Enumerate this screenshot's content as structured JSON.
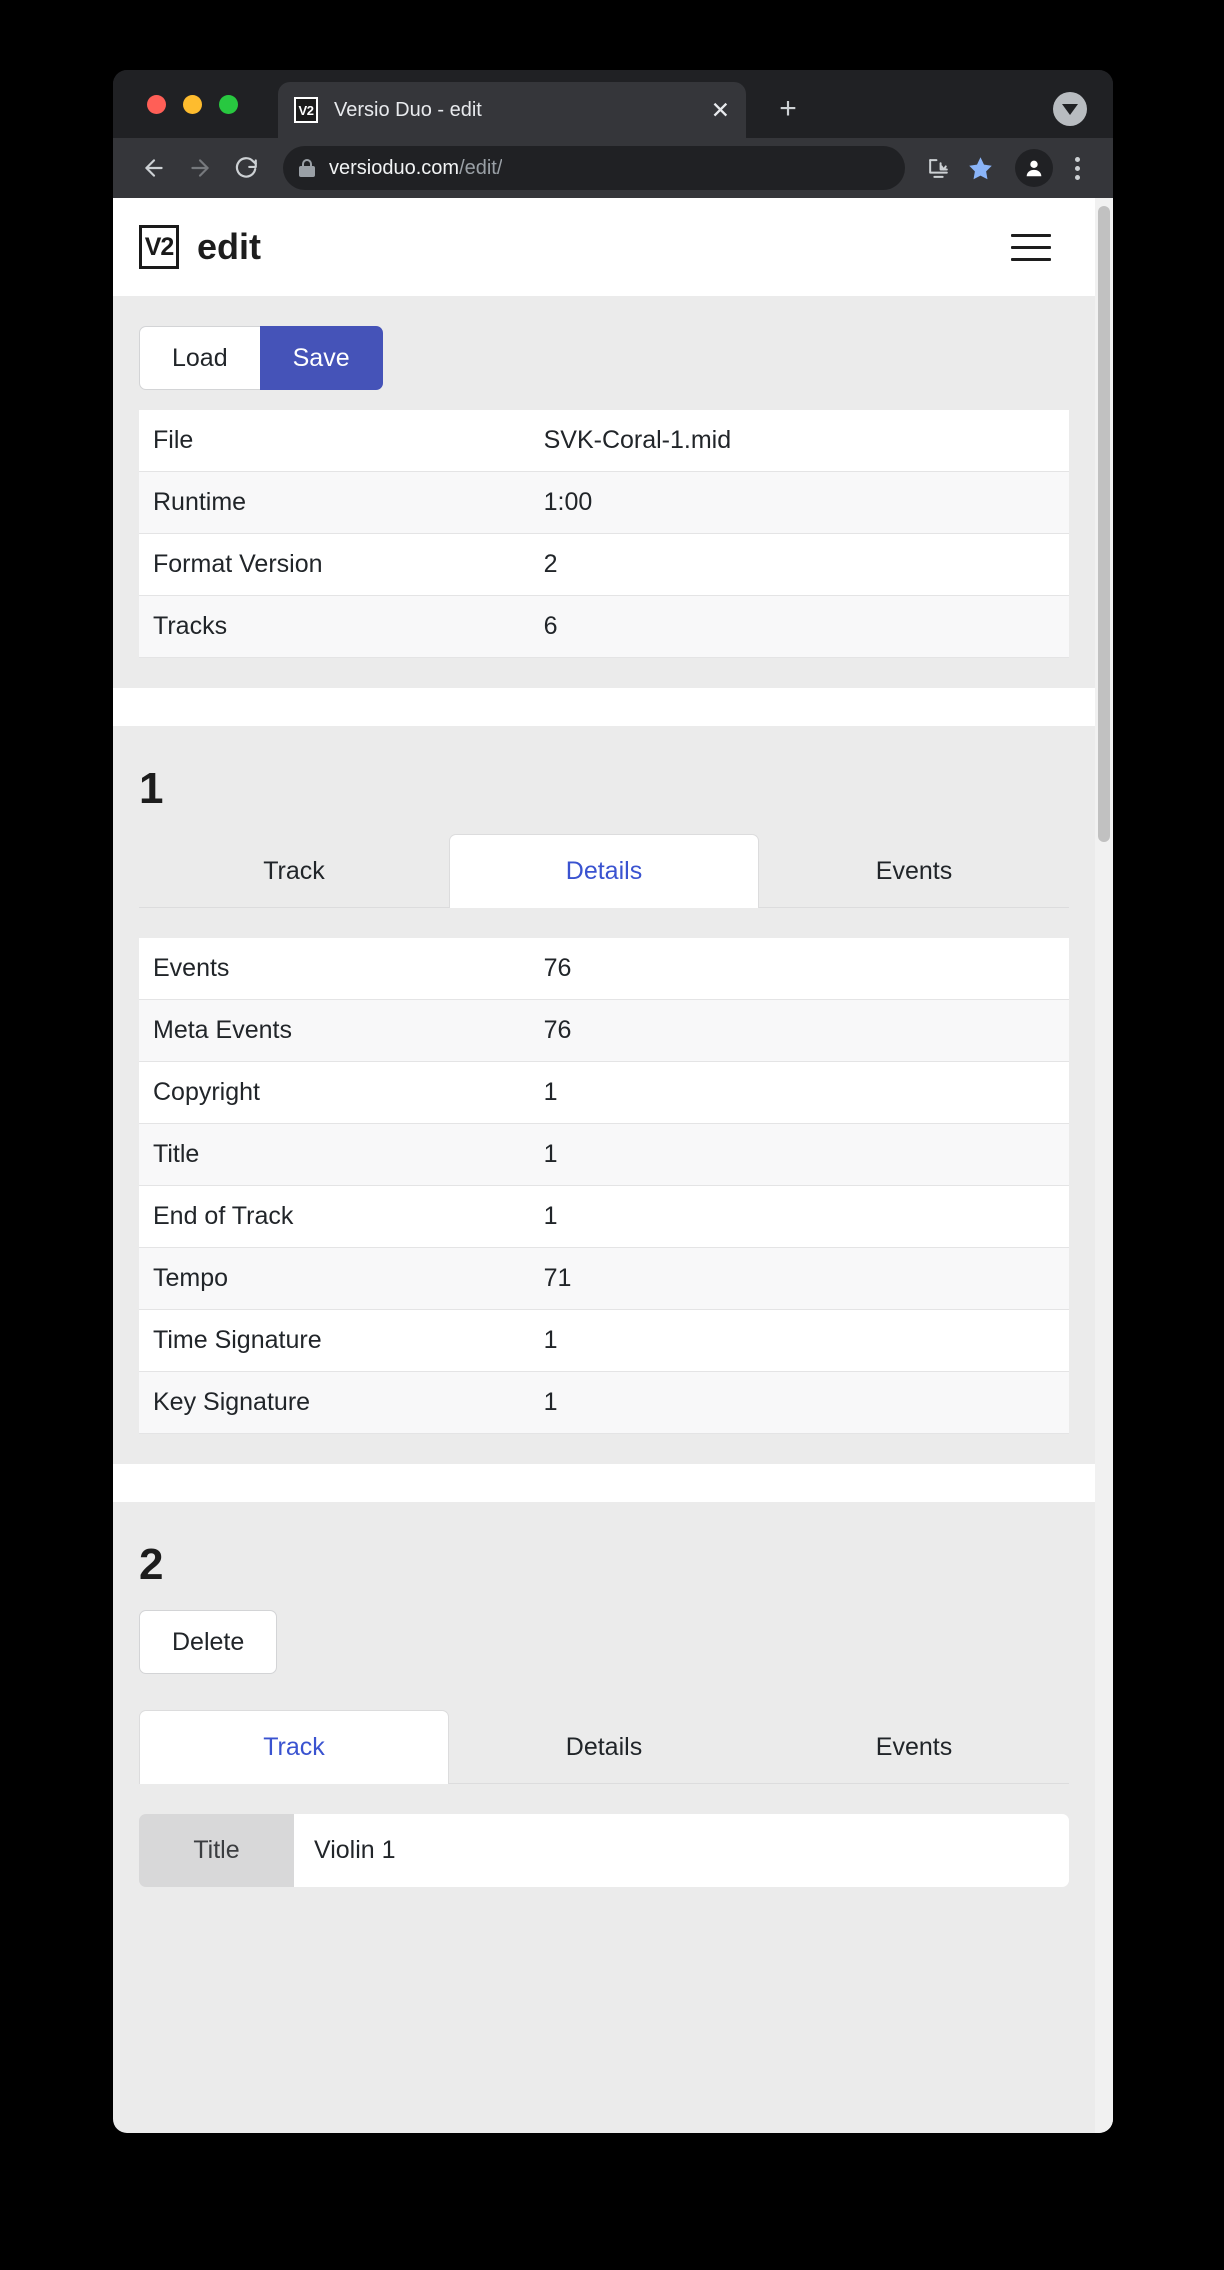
{
  "browser": {
    "tab": {
      "favicon_label": "V2",
      "title": "Versio Duo - edit",
      "close_label": "✕"
    },
    "new_tab_label": "+",
    "url_host": "versioduo.com",
    "url_path": "/edit/",
    "back_icon": "back-arrow-icon",
    "forward_icon": "forward-arrow-icon",
    "reload_icon": "reload-icon",
    "lock_icon": "lock-icon",
    "download_icon": "download-icon",
    "bookmark_icon": "star-icon",
    "profile_icon": "person-icon",
    "menu_icon": "three-dots-icon",
    "tab_search_icon": "chevron-down-circle-icon",
    "accent_blue": "#8ab4f8"
  },
  "app": {
    "logo_label": "V2",
    "title": "edit",
    "menu_icon": "hamburger-icon"
  },
  "toolbar": {
    "load_label": "Load",
    "save_label": "Save",
    "save_color": "#4553b8"
  },
  "file_info": {
    "rows": [
      {
        "key": "File",
        "value": "SVK-Coral-1.mid"
      },
      {
        "key": "Runtime",
        "value": "1:00"
      },
      {
        "key": "Format Version",
        "value": "2"
      },
      {
        "key": "Tracks",
        "value": "6"
      }
    ]
  },
  "track1": {
    "number": "1",
    "tabs": [
      {
        "label": "Track",
        "active": false
      },
      {
        "label": "Details",
        "active": true
      },
      {
        "label": "Events",
        "active": false
      }
    ],
    "details": [
      {
        "key": "Events",
        "value": "76"
      },
      {
        "key": "Meta Events",
        "value": "76"
      },
      {
        "key": "Copyright",
        "value": "1"
      },
      {
        "key": "Title",
        "value": "1"
      },
      {
        "key": "End of Track",
        "value": "1"
      },
      {
        "key": "Tempo",
        "value": "71"
      },
      {
        "key": "Time Signature",
        "value": "1"
      },
      {
        "key": "Key Signature",
        "value": "1"
      }
    ]
  },
  "track2": {
    "number": "2",
    "delete_label": "Delete",
    "tabs": [
      {
        "label": "Track",
        "active": true
      },
      {
        "label": "Details",
        "active": false
      },
      {
        "label": "Events",
        "active": false
      }
    ],
    "title_field": {
      "label": "Title",
      "value": "Violin 1",
      "placeholder": ""
    }
  }
}
